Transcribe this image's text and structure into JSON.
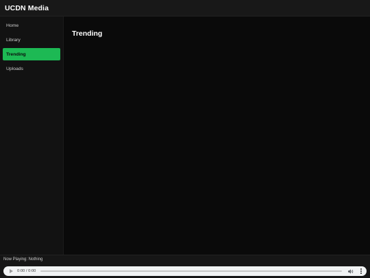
{
  "app": {
    "title": "UCDN Media"
  },
  "sidebar": {
    "items": [
      {
        "label": "Home",
        "active": false
      },
      {
        "label": "Library",
        "active": false
      },
      {
        "label": "Trending",
        "active": true
      },
      {
        "label": "Uploads",
        "active": false
      }
    ]
  },
  "main": {
    "title": "Trending"
  },
  "footer": {
    "now_playing": "Now Playing: Nothing"
  },
  "player": {
    "time": "0:00 / 0:00",
    "progress": 0,
    "icons": {
      "play": "play-icon",
      "volume": "volume-icon",
      "more": "more-options-icon"
    }
  },
  "colors": {
    "accent": "#1db954",
    "background": "#0a0a0a",
    "sidebar": "#121212",
    "topbar": "#181818"
  }
}
